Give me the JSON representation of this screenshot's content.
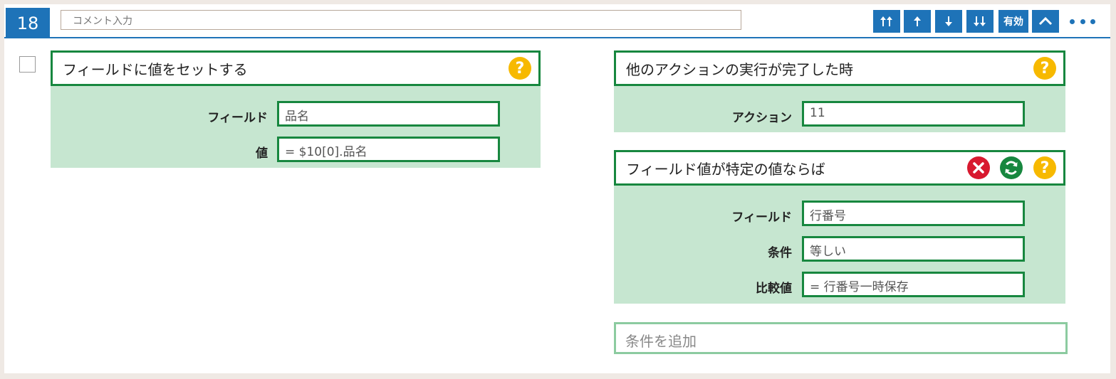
{
  "header": {
    "row_number": "18",
    "comment_placeholder": "コメント入力",
    "enabled_label": "有効"
  },
  "action_panel": {
    "title": "フィールドに値をセットする",
    "help": "?",
    "fields": [
      {
        "label": "フィールド",
        "value": "品名"
      },
      {
        "label": "値",
        "value": "= $10[0].品名"
      }
    ]
  },
  "trigger_panel": {
    "title": "他のアクションの実行が完了した時",
    "help": "?",
    "fields": [
      {
        "label": "アクション",
        "value": "11"
      }
    ]
  },
  "condition_panel": {
    "title": "フィールド値が特定の値ならば",
    "help": "?",
    "fields": [
      {
        "label": "フィールド",
        "value": "行番号"
      },
      {
        "label": "条件",
        "value": "等しい"
      },
      {
        "label": "比較値",
        "value": "= 行番号一時保存"
      }
    ]
  },
  "add_condition_placeholder": "条件を追加",
  "colors": {
    "accent_blue": "#1e73b8",
    "green_border": "#17873f",
    "panel_green": "#c6e6d0",
    "help_yellow": "#f7b900",
    "delete_red": "#d8192f"
  }
}
